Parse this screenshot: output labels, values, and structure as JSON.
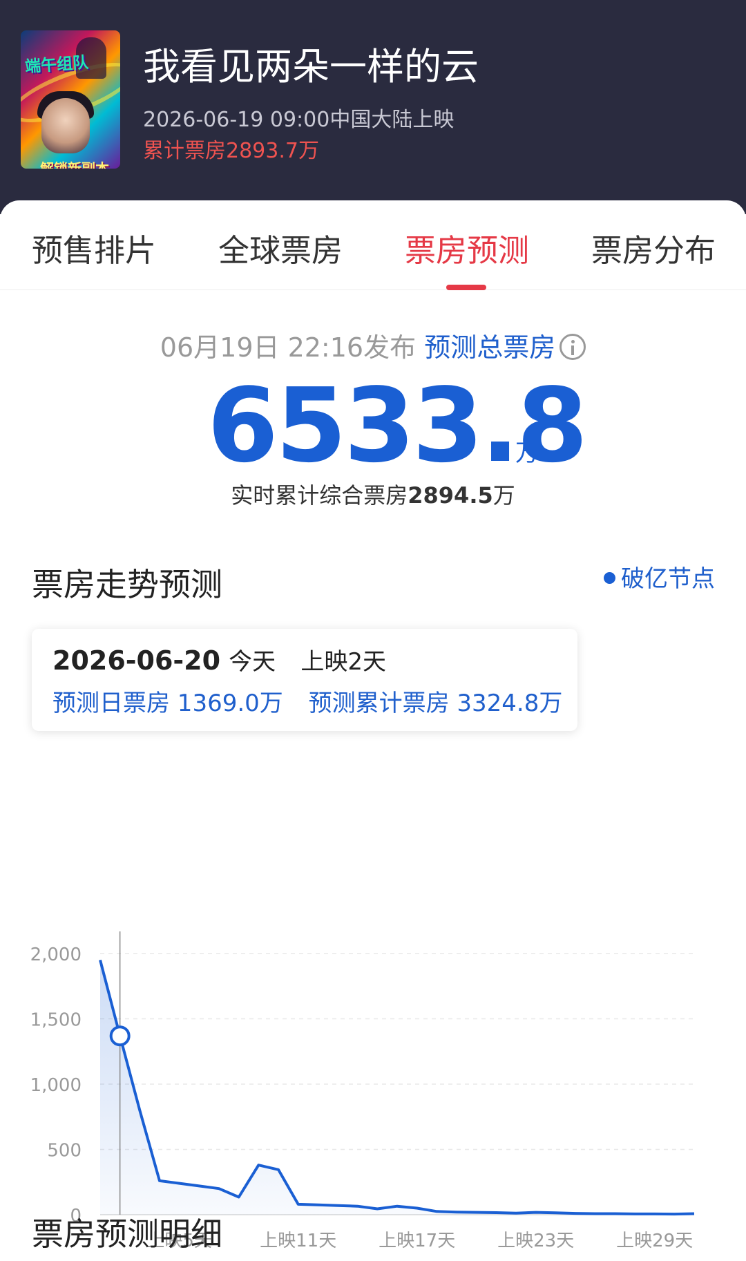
{
  "header": {
    "poster": {
      "text_line_1": "端午组队",
      "text_line_2": "解锁新副本"
    },
    "title": "我看见两朵一样的云",
    "release": "2026-06-19 09:00中国大陆上映",
    "cumulative": "累计票房2893.7万"
  },
  "tabs": [
    {
      "label": "预售排片"
    },
    {
      "label": "全球票房"
    },
    {
      "label": "票房预测",
      "active": true
    },
    {
      "label": "票房分布"
    }
  ],
  "forecast": {
    "published": "06月19日 22:16发布",
    "label": "预测总票房",
    "total": "6533.8",
    "unit": "万",
    "realtime_prefix": "实时累计综合票房",
    "realtime_value": "2894.5",
    "realtime_unit": "万"
  },
  "trend": {
    "title": "票房走势预测",
    "legend": "破亿节点",
    "tooltip": {
      "date": "2026-06-20",
      "today": "今天",
      "day": "上映2天",
      "daily": "预测日票房 1369.0万",
      "cume": "预测累计票房 3324.8万"
    }
  },
  "detail_title": "票房预测明细",
  "colors": {
    "accent_red": "#e53946",
    "accent_blue": "#1a5fd3",
    "header_bg": "#2a2b3f"
  },
  "chart_data": {
    "type": "area",
    "x_unit": "上映天数",
    "x": [
      1,
      2,
      3,
      4,
      5,
      6,
      7,
      8,
      9,
      10,
      11,
      12,
      13,
      14,
      15,
      16,
      17,
      18,
      19,
      20,
      21,
      22,
      23,
      24,
      25,
      26,
      27,
      28,
      29,
      30,
      31
    ],
    "values": [
      1950,
      1369,
      800,
      260,
      240,
      220,
      200,
      135,
      380,
      345,
      80,
      75,
      70,
      65,
      45,
      65,
      50,
      25,
      20,
      18,
      16,
      12,
      18,
      15,
      10,
      8,
      8,
      6,
      6,
      5,
      8
    ],
    "highlight_index": 1,
    "ylim": [
      0,
      2000
    ],
    "y_ticks": [
      {
        "value": 0,
        "label": "0"
      },
      {
        "value": 500,
        "label": "500"
      },
      {
        "value": 1000,
        "label": "1,000"
      },
      {
        "value": 1500,
        "label": "1,500"
      },
      {
        "value": 2000,
        "label": "2,000"
      }
    ],
    "x_ticks": [
      {
        "day": 5,
        "label": "上映5天"
      },
      {
        "day": 11,
        "label": "上映11天"
      },
      {
        "day": 17,
        "label": "上映17天"
      },
      {
        "day": 23,
        "label": "上映23天"
      },
      {
        "day": 29,
        "label": "上映29天"
      }
    ],
    "grid": true
  }
}
